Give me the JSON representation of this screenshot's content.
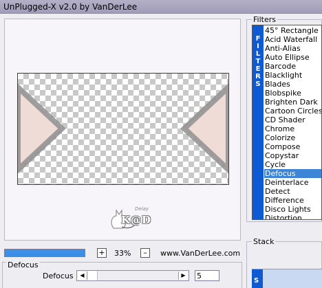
{
  "window": {
    "title": "UnPlugged-X v2.0 by VanDerLee"
  },
  "preview": {
    "logo_text": "K@D",
    "logo_small": "Delay"
  },
  "toolbar": {
    "progress_value": 1.0,
    "zoom_plus": "+",
    "zoom_value": "33%",
    "zoom_minus": "–",
    "credit": "www.VanDerLee.com"
  },
  "parameter": {
    "group_title": "Defocus",
    "label": "Defocus",
    "arrow_left": "◀",
    "arrow_right": "▶",
    "value": "5",
    "slider_fraction": 0.05
  },
  "filters": {
    "title": "Filters",
    "stripe_letters": [
      "F",
      "I",
      "L",
      "T",
      "E",
      "R",
      "S"
    ],
    "items": [
      "45° Rectangle",
      "Acid Waterfall",
      "Anti-Alias",
      "Auto Ellipse",
      "Barcode",
      "Blacklight",
      "Blades",
      "Blobspike",
      "Brighten Dark",
      "Cartoon Circles",
      "CD Shader",
      "Chrome",
      "Colorize",
      "Compose",
      "Copystar",
      "Cycle",
      "Defocus",
      "Deinterlace",
      "Detect",
      "Difference",
      "Disco Lights",
      "Distortion"
    ],
    "selected_index": 16
  },
  "stack": {
    "title": "Stack",
    "stripe_letter": "S"
  },
  "colors": {
    "accent": "#3d85d6",
    "stripe": "#0e5ad4",
    "progress": "#3c8fe6",
    "triangle_fill": "#efdcd7",
    "triangle_edge": "#8f8f8f"
  }
}
